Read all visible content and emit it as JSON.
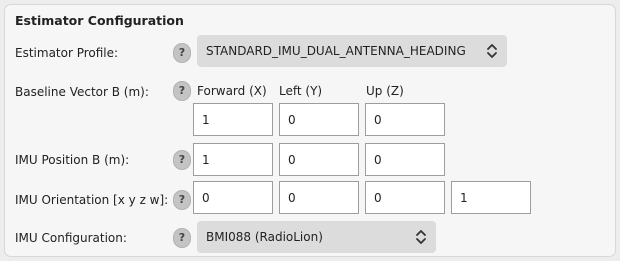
{
  "section": {
    "title": "Estimator Configuration"
  },
  "help_label": "?",
  "rows": {
    "profile": {
      "label": "Estimator Profile:",
      "value": "STANDARD_IMU_DUAL_ANTENNA_HEADING"
    },
    "baseline": {
      "label": "Baseline Vector B (m):",
      "headers": [
        "Forward (X)",
        "Left (Y)",
        "Up (Z)"
      ],
      "values": [
        "1",
        "0",
        "0"
      ]
    },
    "imu_position": {
      "label": "IMU Position B (m):",
      "values": [
        "1",
        "0",
        "0"
      ]
    },
    "imu_orientation": {
      "label": "IMU Orientation [x y z w]:",
      "values": [
        "0",
        "0",
        "0",
        "1"
      ]
    },
    "imu_config": {
      "label": "IMU Configuration:",
      "value": "BMI088 (RadioLion)"
    }
  }
}
